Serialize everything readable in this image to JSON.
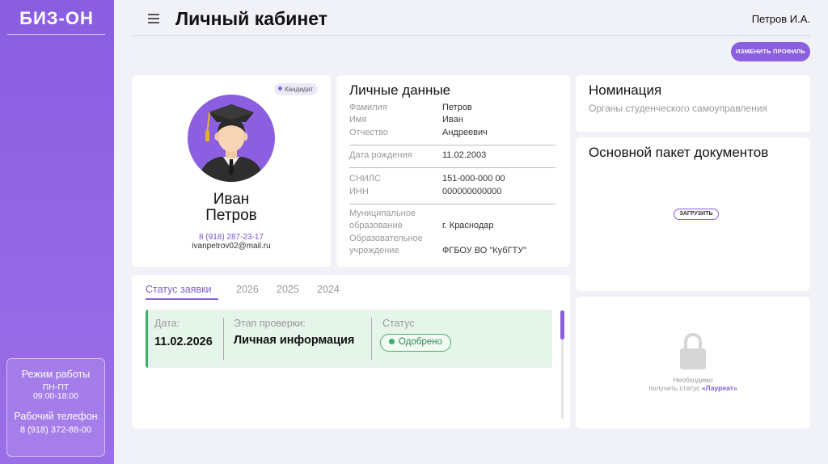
{
  "sidebar": {
    "logo": "БИЗ-ОН",
    "schedule_title": "Режим работы",
    "schedule_days": "ПН-ПТ",
    "schedule_hours": "09:00-18:00",
    "phone_title": "Рабочий телефон",
    "phone": "8 (918) 372-88-00"
  },
  "header": {
    "title": "Личный кабинет",
    "user": "Петров И.А.",
    "edit_profile": "ИЗМЕНИТЬ ПРОФИЛЬ"
  },
  "profile": {
    "badge": "Кандидат",
    "first_name": "Иван",
    "last_name": "Петров",
    "phone": "8 (918) 287-23-17",
    "email": "ivanpetrov02@mail.ru"
  },
  "personal": {
    "title": "Личные данные",
    "surname_label": "Фамилия",
    "surname": "Петров",
    "name_label": "Имя",
    "name": "Иван",
    "patronymic_label": "Отчество",
    "patronymic": "Андреевич",
    "birth_label": "Дата рождения",
    "birth": "11.02.2003",
    "snils_label": "СНИЛС",
    "snils": "151-000-000 00",
    "inn_label": "ИНН",
    "inn": "000000000000",
    "municipal_label_1": "Муниципальное",
    "municipal_label_2": "образование",
    "municipal": "г. Краснодар",
    "edu_label_1": "Образовательное",
    "edu_label_2": "учреждение",
    "edu": "ФГБОУ ВО \"КубГТУ\""
  },
  "status": {
    "tabs": [
      "Статус заявки",
      "2026",
      "2025",
      "2024"
    ],
    "date_label": "Дата:",
    "date": "11.02.2026",
    "stage_label": "Этап проверки:",
    "stage": "Личная информация",
    "status_label": "Статус",
    "status_value": "Одобрено",
    "status_color": "#3cae6a"
  },
  "nomination": {
    "title": "Номинация",
    "value": "Органы студенческого самоуправления"
  },
  "docs": {
    "title": "Основной пакет документов",
    "upload": "ЗАГРУЗИТЬ"
  },
  "locked": {
    "line1": "Необходимо",
    "line2_prefix": "получить статус",
    "line2_status": "«Лауреат»",
    "icon": "lock-icon"
  },
  "colors": {
    "accent": "#8b5fdf",
    "sidebar": "#9066e2",
    "approved": "#3cae6a"
  }
}
